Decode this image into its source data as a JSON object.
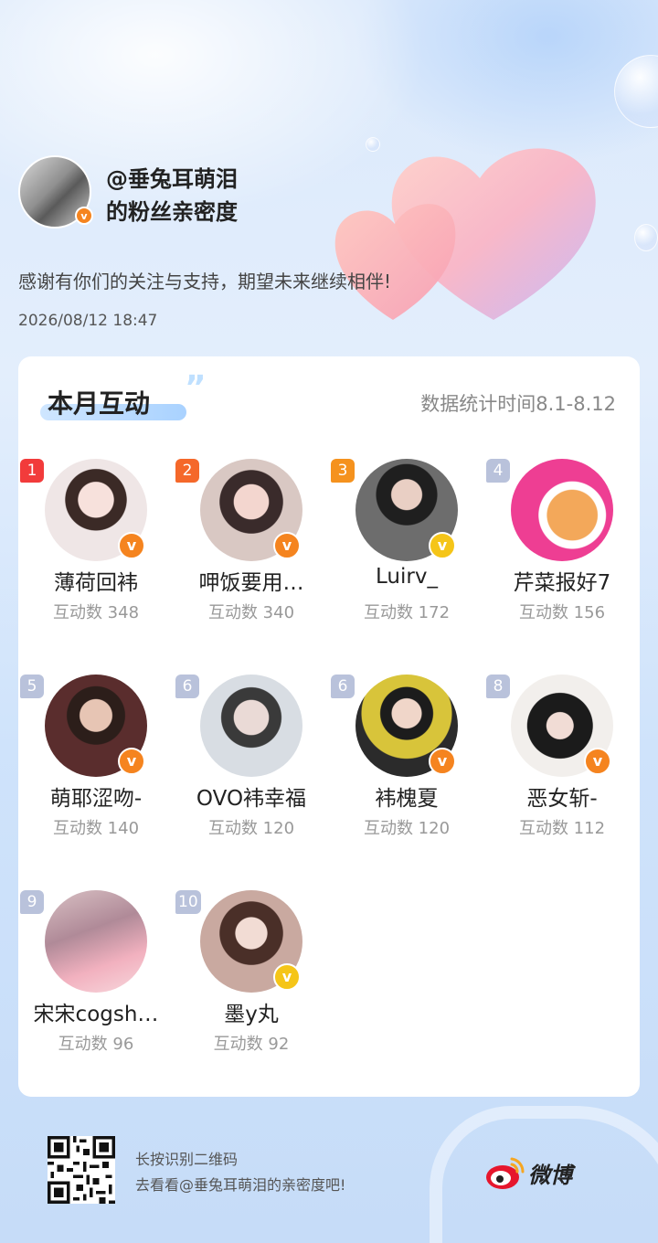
{
  "header": {
    "title_line1": "@垂兔耳萌泪",
    "title_line2": "的粉丝亲密度",
    "subtitle": "感谢有你们的关注与支持，期望未来继续相伴!",
    "datetime": "2026/08/12  18:47",
    "avatar_icon": "user-avatar"
  },
  "card": {
    "title": "本月互动",
    "stat_period": "数据统计时间8.1-8.12",
    "fans": [
      {
        "rank": "1",
        "name": "薄荷回袆",
        "count": "互动数 348",
        "badge": "orange"
      },
      {
        "rank": "2",
        "name": "呷饭要用…",
        "count": "互动数 340",
        "badge": "orange"
      },
      {
        "rank": "3",
        "name": "Luirv_",
        "count": "互动数 172",
        "badge": "gold"
      },
      {
        "rank": "4",
        "name": "芹菜报好7",
        "count": "互动数 156",
        "badge": "none"
      },
      {
        "rank": "5",
        "name": "萌耶涩吻-",
        "count": "互动数 140",
        "badge": "orange"
      },
      {
        "rank": "6",
        "name": "OVO袆幸福",
        "count": "互动数 120",
        "badge": "none"
      },
      {
        "rank": "6",
        "name": "袆槐夏",
        "count": "互动数 120",
        "badge": "orange"
      },
      {
        "rank": "8",
        "name": "恶女斩-",
        "count": "互动数 112",
        "badge": "orange"
      },
      {
        "rank": "9",
        "name": "宋宋cogsh…",
        "count": "互动数 96",
        "badge": "none"
      },
      {
        "rank": "10",
        "name": "墨y丸",
        "count": "互动数 92",
        "badge": "gold"
      }
    ]
  },
  "footer": {
    "line1": "长按识别二维码",
    "line2": "去看看@垂兔耳萌泪的亲密度吧!",
    "brand": "微博",
    "qr_icon": "qr-code-icon",
    "logo_icon": "weibo-logo-icon"
  },
  "colors": {
    "verified_orange": "#f5841f",
    "verified_gold": "#f5c518",
    "rank1": "#f23b3b",
    "rank2": "#f5682a",
    "rank3": "#f5921e",
    "rank_default": "#b9c2db"
  }
}
